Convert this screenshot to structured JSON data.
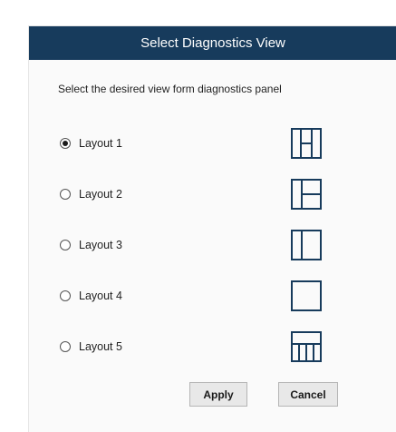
{
  "dialog": {
    "title": "Select Diagnostics View",
    "instruction": "Select the desired view form diagnostics panel",
    "selected_layout": "Layout 1",
    "layouts": [
      {
        "label": "Layout 1",
        "selected": true,
        "icon": "layout-1-icon"
      },
      {
        "label": "Layout 2",
        "selected": false,
        "icon": "layout-2-icon"
      },
      {
        "label": "Layout 3",
        "selected": false,
        "icon": "layout-3-icon"
      },
      {
        "label": "Layout 4",
        "selected": false,
        "icon": "layout-4-icon"
      },
      {
        "label": "Layout 5",
        "selected": false,
        "icon": "layout-5-icon"
      }
    ],
    "apply_label": "Apply",
    "cancel_label": "Cancel"
  },
  "colors": {
    "titlebar": "#173b5c",
    "icon_stroke": "#173b5c",
    "background": "#fafafa"
  }
}
